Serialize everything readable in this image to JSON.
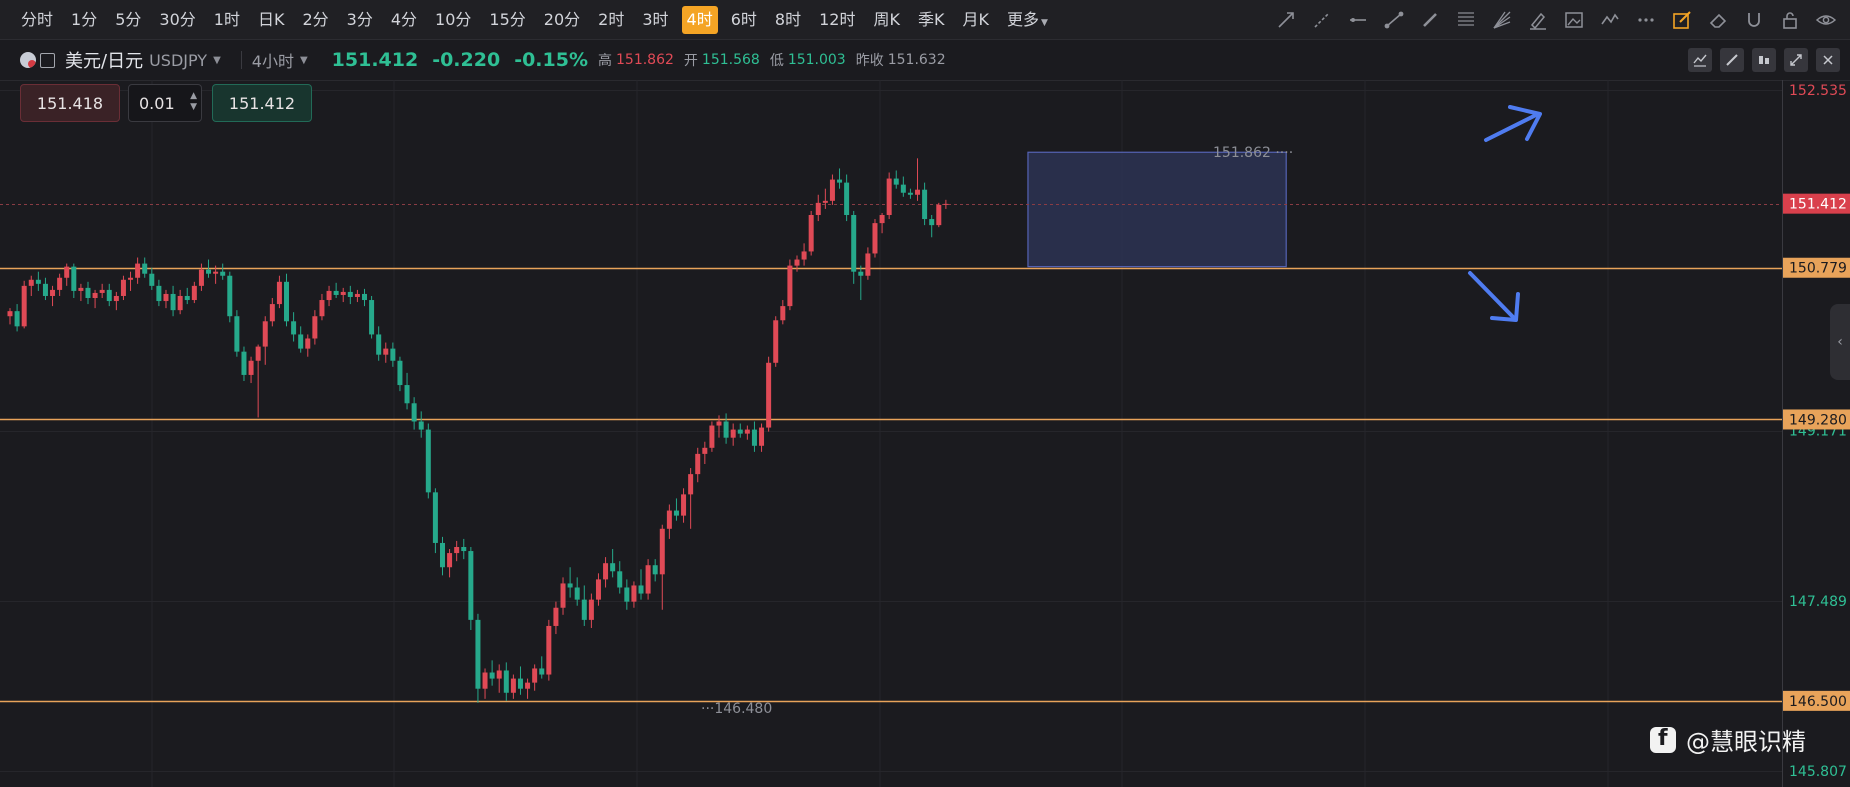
{
  "toolbar": {
    "timeframes": [
      "分时",
      "1分",
      "5分",
      "30分",
      "1时",
      "日K",
      "2分",
      "3分",
      "4分",
      "10分",
      "15分",
      "20分",
      "2时",
      "3时",
      "4时",
      "6时",
      "8时",
      "12时",
      "周K",
      "季K",
      "月K",
      "更多"
    ],
    "active_timeframe": "4时",
    "drawing_tools": [
      "trend-line-icon",
      "ray-line-icon",
      "horizontal-line-icon",
      "segment-icon",
      "pen-icon",
      "fibonacci-icon",
      "gann-fan-icon",
      "highlighter-icon",
      "image-icon",
      "wave-icon",
      "more-dots-icon",
      "edit-active-icon",
      "eraser-icon",
      "magnet-icon",
      "lock-icon",
      "eye-icon"
    ]
  },
  "symbol": {
    "name": "美元/日元",
    "code": "USDJPY",
    "period": "4小时",
    "price": "151.412",
    "change": "-0.220",
    "change_pct": "-0.15%",
    "high_label": "高",
    "high": "151.862",
    "open_label": "开",
    "open": "151.568",
    "low_label": "低",
    "low": "151.003",
    "prev_label": "昨收",
    "prev_close": "151.632"
  },
  "order": {
    "sell_price": "151.418",
    "quantity": "0.01",
    "buy_price": "151.412"
  },
  "watermark": "@慧眼识精",
  "colors": {
    "up": "#e04a56",
    "down": "#26a98b",
    "level_line": "#e8a35a",
    "box_fill": "#2c3253",
    "box_border": "#5563b5",
    "arrow": "#4f7cf0"
  },
  "chart_data": {
    "type": "candlestick",
    "symbol": "USDJPY",
    "timeframe": "4H",
    "ylim": [
      145.807,
      152.535
    ],
    "y_ticks": [
      {
        "value": 152.535,
        "label": "152.535",
        "color": "#e04a56"
      },
      {
        "value": 150.779,
        "label": "150.779",
        "color": "#9a9ca4"
      },
      {
        "value": 149.171,
        "label": "149.171",
        "color": "#2fbf94"
      },
      {
        "value": 147.489,
        "label": "147.489",
        "color": "#2fbf94"
      },
      {
        "value": 145.807,
        "label": "145.807",
        "color": "#2fbf94"
      }
    ],
    "current_price": 151.412,
    "horizontal_levels": [
      150.779,
      149.28,
      146.5
    ],
    "annotations": {
      "high_marker": 151.862,
      "low_marker": 146.48
    },
    "box": {
      "x_start": 144,
      "x_end": 180,
      "y_top": 151.92,
      "y_bottom": 150.79
    },
    "arrows": [
      {
        "direction": "up"
      },
      {
        "direction": "down"
      }
    ],
    "candles": [
      [
        150.3,
        150.38,
        150.22,
        150.35
      ],
      [
        150.35,
        150.42,
        150.15,
        150.2
      ],
      [
        150.2,
        150.65,
        150.18,
        150.6
      ],
      [
        150.6,
        150.7,
        150.5,
        150.66
      ],
      [
        150.66,
        150.74,
        150.55,
        150.62
      ],
      [
        150.62,
        150.68,
        150.46,
        150.5
      ],
      [
        150.5,
        150.6,
        150.4,
        150.56
      ],
      [
        150.56,
        150.72,
        150.5,
        150.68
      ],
      [
        150.68,
        150.82,
        150.6,
        150.79
      ],
      [
        150.79,
        150.82,
        150.48,
        150.55
      ],
      [
        150.55,
        150.62,
        150.45,
        150.58
      ],
      [
        150.58,
        150.64,
        150.42,
        150.48
      ],
      [
        150.48,
        150.56,
        150.38,
        150.53
      ],
      [
        150.53,
        150.62,
        150.48,
        150.56
      ],
      [
        150.56,
        150.62,
        150.4,
        150.45
      ],
      [
        150.45,
        150.54,
        150.36,
        150.5
      ],
      [
        150.5,
        150.7,
        150.46,
        150.66
      ],
      [
        150.66,
        150.74,
        150.55,
        150.68
      ],
      [
        150.68,
        150.88,
        150.62,
        150.82
      ],
      [
        150.82,
        150.88,
        150.68,
        150.72
      ],
      [
        150.72,
        150.78,
        150.56,
        150.6
      ],
      [
        150.6,
        150.66,
        150.4,
        150.45
      ],
      [
        150.45,
        150.56,
        150.38,
        150.52
      ],
      [
        150.52,
        150.6,
        150.3,
        150.36
      ],
      [
        150.36,
        150.56,
        150.32,
        150.5
      ],
      [
        150.5,
        150.58,
        150.42,
        150.46
      ],
      [
        150.46,
        150.64,
        150.43,
        150.6
      ],
      [
        150.6,
        150.82,
        150.55,
        150.76
      ],
      [
        150.76,
        150.86,
        150.68,
        150.72
      ],
      [
        150.72,
        150.8,
        150.62,
        150.74
      ],
      [
        150.74,
        150.82,
        150.66,
        150.7
      ],
      [
        150.7,
        150.74,
        150.24,
        150.3
      ],
      [
        150.3,
        150.36,
        149.9,
        149.95
      ],
      [
        149.95,
        150.0,
        149.66,
        149.72
      ],
      [
        149.72,
        149.9,
        149.64,
        149.86
      ],
      [
        149.86,
        150.02,
        149.3,
        150.0
      ],
      [
        150.0,
        150.3,
        149.82,
        150.25
      ],
      [
        150.25,
        150.48,
        150.2,
        150.42
      ],
      [
        150.42,
        150.7,
        150.38,
        150.64
      ],
      [
        150.64,
        150.72,
        150.2,
        150.25
      ],
      [
        150.25,
        150.34,
        150.05,
        150.12
      ],
      [
        150.12,
        150.2,
        149.94,
        149.98
      ],
      [
        149.98,
        150.12,
        149.9,
        150.08
      ],
      [
        150.08,
        150.36,
        150.02,
        150.3
      ],
      [
        150.3,
        150.52,
        150.26,
        150.46
      ],
      [
        150.46,
        150.6,
        150.4,
        150.55
      ],
      [
        150.55,
        150.63,
        150.48,
        150.51
      ],
      [
        150.51,
        150.58,
        150.44,
        150.54
      ],
      [
        150.54,
        150.6,
        150.42,
        150.49
      ],
      [
        150.49,
        150.56,
        150.44,
        150.52
      ],
      [
        150.52,
        150.57,
        150.4,
        150.46
      ],
      [
        150.46,
        150.5,
        150.08,
        150.12
      ],
      [
        150.12,
        150.2,
        149.86,
        149.92
      ],
      [
        149.92,
        150.04,
        149.84,
        149.98
      ],
      [
        149.98,
        150.04,
        149.8,
        149.86
      ],
      [
        149.86,
        149.9,
        149.56,
        149.62
      ],
      [
        149.62,
        149.74,
        149.38,
        149.44
      ],
      [
        149.44,
        149.5,
        149.18,
        149.26
      ],
      [
        149.26,
        149.36,
        149.1,
        149.18
      ],
      [
        149.18,
        149.24,
        148.5,
        148.56
      ],
      [
        148.56,
        148.6,
        147.96,
        148.06
      ],
      [
        148.06,
        148.12,
        147.74,
        147.82
      ],
      [
        147.82,
        148.0,
        147.72,
        147.96
      ],
      [
        147.96,
        148.08,
        147.88,
        148.02
      ],
      [
        148.02,
        148.1,
        147.9,
        147.98
      ],
      [
        147.98,
        148.02,
        147.2,
        147.3
      ],
      [
        147.3,
        147.36,
        146.48,
        146.62
      ],
      [
        146.62,
        146.82,
        146.52,
        146.78
      ],
      [
        146.78,
        146.9,
        146.65,
        146.72
      ],
      [
        146.72,
        146.86,
        146.58,
        146.8
      ],
      [
        146.8,
        146.88,
        146.5,
        146.58
      ],
      [
        146.58,
        146.76,
        146.52,
        146.72
      ],
      [
        146.72,
        146.84,
        146.56,
        146.62
      ],
      [
        146.62,
        146.72,
        146.52,
        146.68
      ],
      [
        146.68,
        146.86,
        146.6,
        146.82
      ],
      [
        146.82,
        146.94,
        146.72,
        146.76
      ],
      [
        146.76,
        147.3,
        146.7,
        147.24
      ],
      [
        147.24,
        147.48,
        147.16,
        147.42
      ],
      [
        147.42,
        147.72,
        147.35,
        147.66
      ],
      [
        147.66,
        147.82,
        147.52,
        147.62
      ],
      [
        147.62,
        147.72,
        147.44,
        147.5
      ],
      [
        147.5,
        147.64,
        147.24,
        147.3
      ],
      [
        147.3,
        147.56,
        147.22,
        147.5
      ],
      [
        147.5,
        147.76,
        147.44,
        147.7
      ],
      [
        147.7,
        147.92,
        147.62,
        147.86
      ],
      [
        147.86,
        148.0,
        147.72,
        147.78
      ],
      [
        147.78,
        147.88,
        147.56,
        147.62
      ],
      [
        147.62,
        147.7,
        147.4,
        147.48
      ],
      [
        147.48,
        147.68,
        147.42,
        147.64
      ],
      [
        147.64,
        147.8,
        147.5,
        147.56
      ],
      [
        147.56,
        147.9,
        147.5,
        147.84
      ],
      [
        147.84,
        147.9,
        147.68,
        147.75
      ],
      [
        147.75,
        148.24,
        147.4,
        148.2
      ],
      [
        148.2,
        148.44,
        148.1,
        148.38
      ],
      [
        148.38,
        148.5,
        148.28,
        148.33
      ],
      [
        148.33,
        148.6,
        148.26,
        148.54
      ],
      [
        148.54,
        148.8,
        148.2,
        148.74
      ],
      [
        148.74,
        149.0,
        148.66,
        148.94
      ],
      [
        148.94,
        149.06,
        148.84,
        149.0
      ],
      [
        149.0,
        149.26,
        148.96,
        149.22
      ],
      [
        149.22,
        149.32,
        149.1,
        149.26
      ],
      [
        149.26,
        149.34,
        149.04,
        149.1
      ],
      [
        149.1,
        149.24,
        149.02,
        149.18
      ],
      [
        149.18,
        149.24,
        149.1,
        149.14
      ],
      [
        149.14,
        149.22,
        149.08,
        149.18
      ],
      [
        149.18,
        149.26,
        148.96,
        149.02
      ],
      [
        149.02,
        149.24,
        148.96,
        149.2
      ],
      [
        149.2,
        149.9,
        149.16,
        149.84
      ],
      [
        149.84,
        150.3,
        149.8,
        150.26
      ],
      [
        150.26,
        150.46,
        150.22,
        150.4
      ],
      [
        150.4,
        150.86,
        150.36,
        150.8
      ],
      [
        150.8,
        150.9,
        150.74,
        150.86
      ],
      [
        150.86,
        151.02,
        150.8,
        150.94
      ],
      [
        150.94,
        151.34,
        150.9,
        151.3
      ],
      [
        151.3,
        151.5,
        151.24,
        151.42
      ],
      [
        151.42,
        151.56,
        151.36,
        151.44
      ],
      [
        151.44,
        151.7,
        151.4,
        151.65
      ],
      [
        151.65,
        151.76,
        151.56,
        151.62
      ],
      [
        151.62,
        151.7,
        151.24,
        151.3
      ],
      [
        151.3,
        151.34,
        150.62,
        150.74
      ],
      [
        150.74,
        150.8,
        150.46,
        150.7
      ],
      [
        150.7,
        150.98,
        150.66,
        150.92
      ],
      [
        150.92,
        151.26,
        150.88,
        151.22
      ],
      [
        151.22,
        151.32,
        151.12,
        151.3
      ],
      [
        151.3,
        151.72,
        151.26,
        151.66
      ],
      [
        151.66,
        151.74,
        151.56,
        151.6
      ],
      [
        151.6,
        151.68,
        151.48,
        151.52
      ],
      [
        151.52,
        151.56,
        151.46,
        151.5
      ],
      [
        151.5,
        151.86,
        151.44,
        151.55
      ],
      [
        151.55,
        151.62,
        151.2,
        151.26
      ],
      [
        151.26,
        151.3,
        151.08,
        151.2
      ],
      [
        151.2,
        151.42,
        151.18,
        151.4
      ],
      [
        151.4,
        151.45,
        151.36,
        151.41
      ]
    ]
  }
}
